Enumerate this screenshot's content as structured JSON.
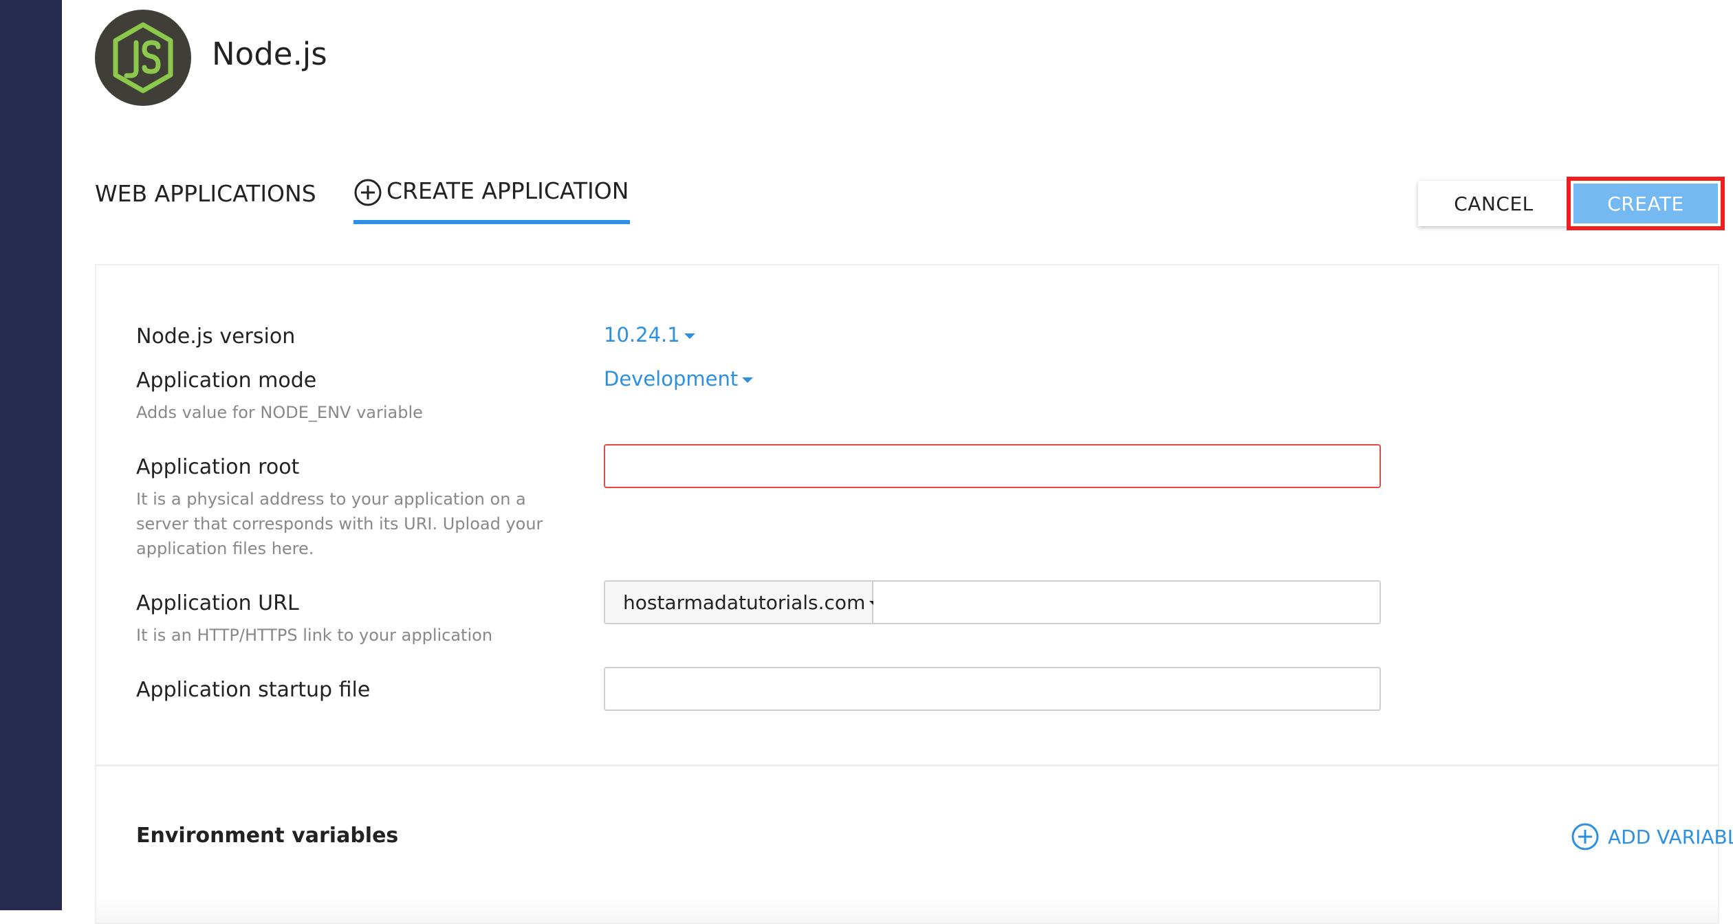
{
  "app": {
    "title": "Node.js",
    "logo_icon": "nodejs-logo-icon"
  },
  "tabs": [
    {
      "label": "WEB APPLICATIONS",
      "active": false
    },
    {
      "label": "CREATE APPLICATION",
      "active": true,
      "icon": "plus-circle-icon"
    }
  ],
  "actions": {
    "cancel_label": "CANCEL",
    "create_label": "CREATE"
  },
  "form": {
    "node_version": {
      "label": "Node.js version",
      "value": "10.24.1"
    },
    "app_mode": {
      "label": "Application mode",
      "value": "Development",
      "hint": "Adds value for NODE_ENV variable"
    },
    "app_root": {
      "label": "Application root",
      "value": "",
      "hint": "It is a physical address to your application on a server that corresponds with its URI. Upload your application files here."
    },
    "app_url": {
      "label": "Application URL",
      "domain": "hostarmadatutorials.com",
      "path": "",
      "hint": "It is an HTTP/HTTPS link to your application"
    },
    "startup_file": {
      "label": "Application startup file",
      "value": ""
    }
  },
  "env": {
    "title": "Environment variables",
    "add_label": "ADD VARIABLE"
  },
  "colors": {
    "sidebar": "#262a4f",
    "accent": "#2c90e6",
    "create_button": "#74b9f2",
    "highlight_border": "#f01e1e",
    "error_border": "#e34848",
    "logo_green": "#8cc84b"
  }
}
